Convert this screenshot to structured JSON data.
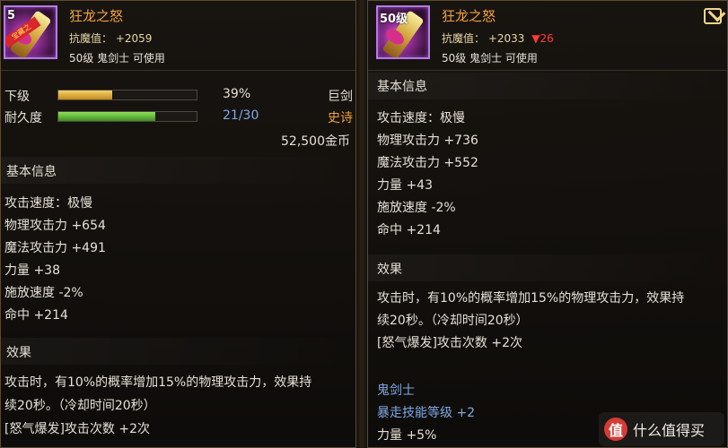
{
  "left_panel": {
    "icon": {
      "level_tag": "5",
      "ribbon": "宝藏之",
      "icon_name": "sword-item-icon"
    },
    "item_name": "狂龙之怒",
    "magic_defense": {
      "label": "抗魔值：",
      "value": "+2059"
    },
    "requirement": "50级 鬼剑士 可使用",
    "level_row": {
      "label": "下级",
      "value": "39%",
      "right": "巨剑",
      "fill": 0.39
    },
    "durability_row": {
      "label": "耐久度",
      "value": "21/30",
      "right": "史诗",
      "fill": 0.7
    },
    "price": "52,500金币",
    "basic_title": "基本信息",
    "stats": [
      "攻击速度：极慢",
      "物理攻击力 +654",
      "魔法攻击力 +491",
      "力量 +38",
      "施放速度 -2%",
      "命中 +214"
    ],
    "effect_title": "效果",
    "effect_lines": [
      "攻击时，有10%的概率增加15%的物理攻击力，效果持",
      "续20秒。（冷却时间20秒）",
      "[怒气爆发]攻击次数 +2次"
    ]
  },
  "right_panel": {
    "icon": {
      "level_tag": "50级",
      "icon_name": "sword-item-icon"
    },
    "item_name": "狂龙之怒",
    "magic_defense": {
      "label": "抗魔值：",
      "value": "+2033",
      "arrow": "▼",
      "diff": "26"
    },
    "requirement": "50级 鬼剑士 可使用",
    "basic_title": "基本信息",
    "stats": [
      "攻击速度：极慢",
      "物理攻击力 +736",
      "魔法攻击力 +552",
      "力量 +43",
      "施放速度 -2%",
      "命中 +214"
    ],
    "effect_title": "效果",
    "effect_lines": [
      "攻击时，有10%的概率增加15%的物理攻击力，效果持",
      "续20秒。（冷却时间20秒）",
      "[怒气爆发]攻击次数 +2次"
    ],
    "class_title": "鬼剑士",
    "class_bonus": "暴走技能等级 +2",
    "extra_stat": "力量 +5%"
  },
  "watermark": {
    "logo": "值",
    "text": "什么值得买"
  },
  "colors": {
    "gold": "#f0a23c",
    "epic": "#f0a23c",
    "blue": "#7fa9e3",
    "down": "#ff3b3b",
    "level_bar": "#e7b33a",
    "durability_bar": "#63b53b"
  }
}
